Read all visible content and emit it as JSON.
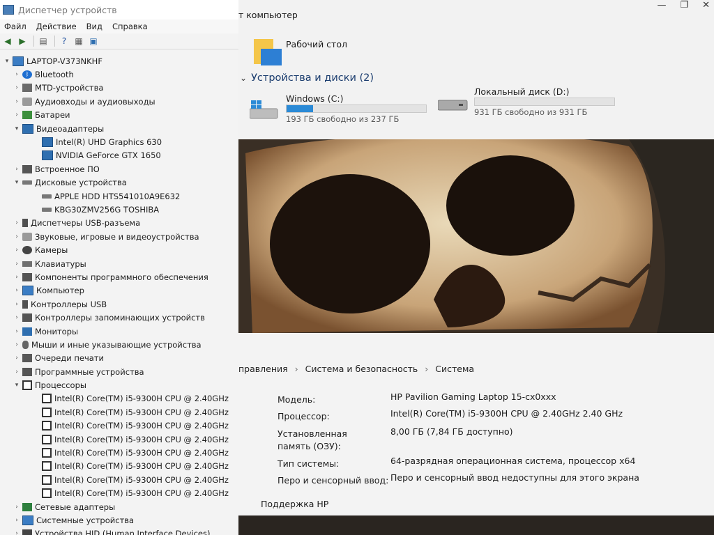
{
  "device_manager": {
    "title": "Диспетчер устройств",
    "menu": [
      "Файл",
      "Действие",
      "Вид",
      "Справка"
    ],
    "tree": [
      {
        "level": 0,
        "expander": "▾",
        "icon": "computer-icon",
        "label": "LAPTOP-V373NKHF"
      },
      {
        "level": 1,
        "expander": "›",
        "icon": "bluetooth-icon",
        "label": "Bluetooth"
      },
      {
        "level": 1,
        "expander": "›",
        "icon": "mtd-icon",
        "label": "MTD-устройства"
      },
      {
        "level": 1,
        "expander": "›",
        "icon": "audio-icon",
        "label": "Аудиовходы и аудиовыходы"
      },
      {
        "level": 1,
        "expander": "›",
        "icon": "battery-icon",
        "label": "Батареи"
      },
      {
        "level": 1,
        "expander": "▾",
        "icon": "display-adapter-icon",
        "label": "Видеоадаптеры"
      },
      {
        "level": 2,
        "expander": "",
        "icon": "display-adapter-icon",
        "label": "Intel(R) UHD Graphics 630"
      },
      {
        "level": 2,
        "expander": "",
        "icon": "display-adapter-icon",
        "label": "NVIDIA GeForce GTX 1650"
      },
      {
        "level": 1,
        "expander": "›",
        "icon": "firmware-icon",
        "label": "Встроенное ПО"
      },
      {
        "level": 1,
        "expander": "▾",
        "icon": "disk-icon",
        "label": "Дисковые устройства"
      },
      {
        "level": 2,
        "expander": "",
        "icon": "disk-icon",
        "label": "APPLE HDD HTS541010A9E632"
      },
      {
        "level": 2,
        "expander": "",
        "icon": "disk-icon",
        "label": "KBG30ZMV256G TOSHIBA"
      },
      {
        "level": 1,
        "expander": "›",
        "icon": "usb-connector-icon",
        "label": "Диспетчеры USB-разъема"
      },
      {
        "level": 1,
        "expander": "›",
        "icon": "sound-icon",
        "label": "Звуковые, игровые и видеоустройства"
      },
      {
        "level": 1,
        "expander": "›",
        "icon": "camera-icon",
        "label": "Камеры"
      },
      {
        "level": 1,
        "expander": "›",
        "icon": "keyboard-icon",
        "label": "Клавиатуры"
      },
      {
        "level": 1,
        "expander": "›",
        "icon": "software-component-icon",
        "label": "Компоненты программного обеспечения"
      },
      {
        "level": 1,
        "expander": "›",
        "icon": "computer-icon",
        "label": "Компьютер"
      },
      {
        "level": 1,
        "expander": "›",
        "icon": "usb-icon",
        "label": "Контроллеры USB"
      },
      {
        "level": 1,
        "expander": "›",
        "icon": "storage-controller-icon",
        "label": "Контроллеры запоминающих устройств"
      },
      {
        "level": 1,
        "expander": "›",
        "icon": "monitor-icon",
        "label": "Мониторы"
      },
      {
        "level": 1,
        "expander": "›",
        "icon": "mouse-icon",
        "label": "Мыши и иные указывающие устройства"
      },
      {
        "level": 1,
        "expander": "›",
        "icon": "print-queue-icon",
        "label": "Очереди печати"
      },
      {
        "level": 1,
        "expander": "›",
        "icon": "software-device-icon",
        "label": "Программные устройства"
      },
      {
        "level": 1,
        "expander": "▾",
        "icon": "processor-icon",
        "label": "Процессоры"
      },
      {
        "level": 2,
        "expander": "",
        "icon": "processor-icon",
        "label": "Intel(R) Core(TM) i5-9300H CPU @ 2.40GHz"
      },
      {
        "level": 2,
        "expander": "",
        "icon": "processor-icon",
        "label": "Intel(R) Core(TM) i5-9300H CPU @ 2.40GHz"
      },
      {
        "level": 2,
        "expander": "",
        "icon": "processor-icon",
        "label": "Intel(R) Core(TM) i5-9300H CPU @ 2.40GHz"
      },
      {
        "level": 2,
        "expander": "",
        "icon": "processor-icon",
        "label": "Intel(R) Core(TM) i5-9300H CPU @ 2.40GHz"
      },
      {
        "level": 2,
        "expander": "",
        "icon": "processor-icon",
        "label": "Intel(R) Core(TM) i5-9300H CPU @ 2.40GHz"
      },
      {
        "level": 2,
        "expander": "",
        "icon": "processor-icon",
        "label": "Intel(R) Core(TM) i5-9300H CPU @ 2.40GHz"
      },
      {
        "level": 2,
        "expander": "",
        "icon": "processor-icon",
        "label": "Intel(R) Core(TM) i5-9300H CPU @ 2.40GHz"
      },
      {
        "level": 2,
        "expander": "",
        "icon": "processor-icon",
        "label": "Intel(R) Core(TM) i5-9300H CPU @ 2.40GHz"
      },
      {
        "level": 1,
        "expander": "›",
        "icon": "network-adapter-icon",
        "label": "Сетевые адаптеры"
      },
      {
        "level": 1,
        "expander": "›",
        "icon": "system-device-icon",
        "label": "Системные устройства"
      },
      {
        "level": 1,
        "expander": "›",
        "icon": "hid-icon",
        "label": "Устройства HID (Human Interface Devices)"
      }
    ]
  },
  "explorer": {
    "title_fragment": "т компьютер",
    "desktop_label": "Рабочий стол",
    "devices_header": "Устройства и диски (2)",
    "drives": [
      {
        "name": "Windows (C:)",
        "free": "193 ГБ свободно из 237 ГБ",
        "used_fraction": 0.19,
        "icon": "windows-drive-icon"
      },
      {
        "name": "Локальный диск (D:)",
        "free": "931 ГБ свободно из 931 ГБ",
        "used_fraction": 0.0,
        "icon": "local-disk-icon"
      }
    ],
    "colors": {
      "accent": "#2b8ad6"
    }
  },
  "system": {
    "breadcrumb": [
      "правления",
      "Система и безопасность",
      "Система"
    ],
    "specs": [
      {
        "label": "Модель:",
        "value": "HP Pavilion Gaming Laptop 15-cx0xxx"
      },
      {
        "label": "Процессор:",
        "value": "Intel(R) Core(TM) i5-9300H CPU @ 2.40GHz   2.40 GHz"
      },
      {
        "label": "Установленная память (ОЗУ):",
        "value": "8,00 ГБ (7,84 ГБ доступно)"
      },
      {
        "label": "Тип системы:",
        "value": "64-разрядная операционная система, процессор x64"
      },
      {
        "label": "Перо и сенсорный ввод:",
        "value": "Перо и сенсорный ввод недоступны для этого экрана"
      }
    ],
    "support": "Поддержка HP"
  }
}
